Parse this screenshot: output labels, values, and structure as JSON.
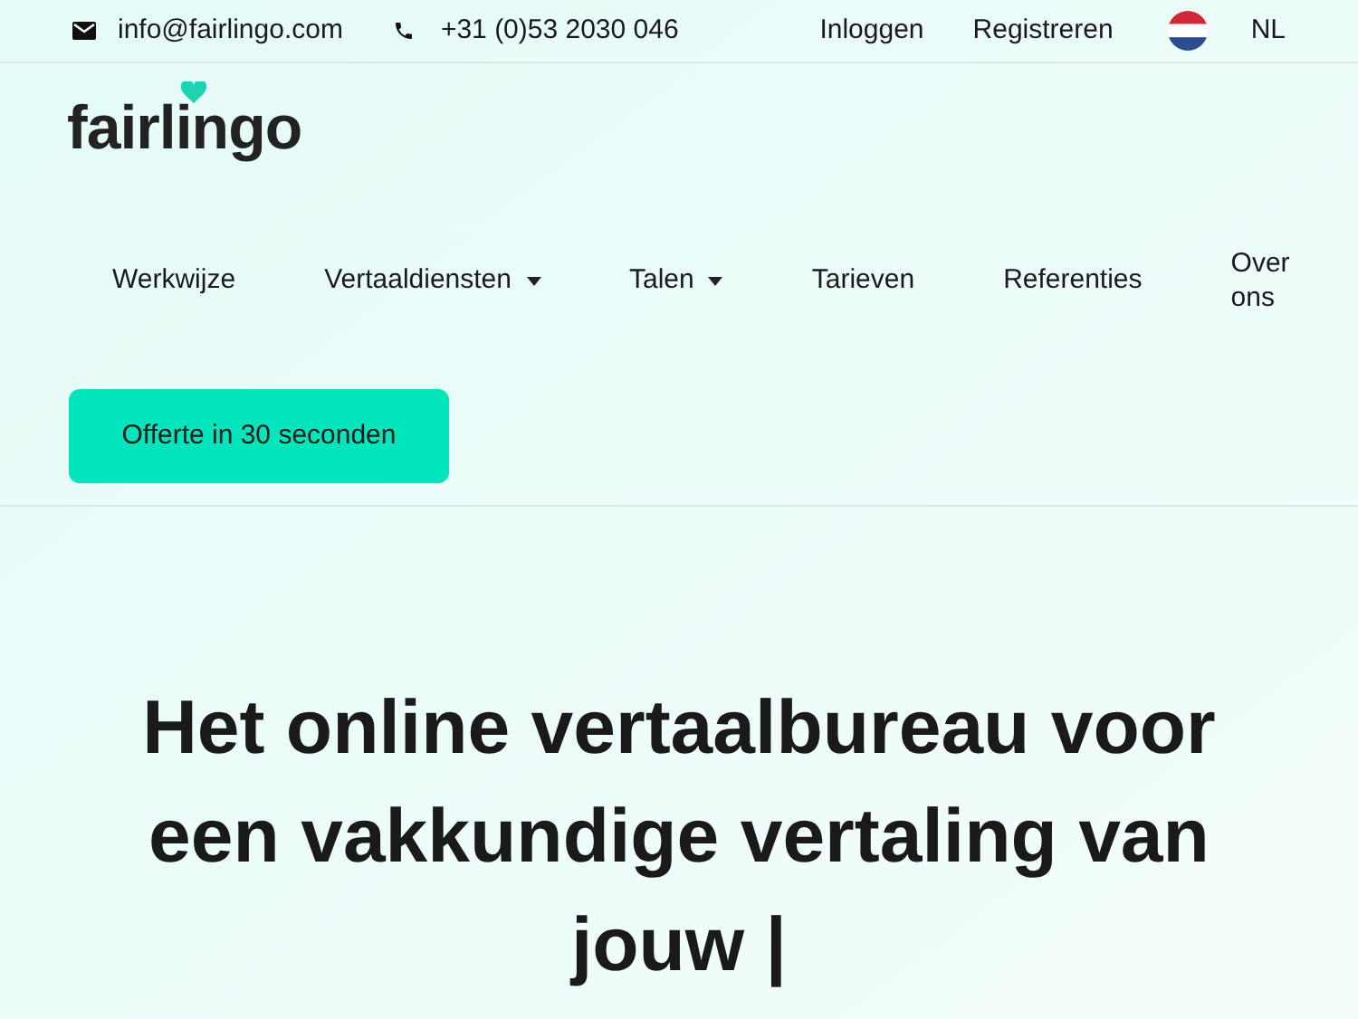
{
  "topbar": {
    "email": "info@fairlingo.com",
    "phone": "+31 (0)53 2030 046",
    "links": [
      "Inloggen",
      "Registreren"
    ],
    "language": "NL"
  },
  "logo": "fairlingo",
  "nav": [
    {
      "label": "Werkwijze",
      "dropdown": false
    },
    {
      "label": "Vertaaldiensten",
      "dropdown": true
    },
    {
      "label": "Talen",
      "dropdown": true
    },
    {
      "label": "Tarieven",
      "dropdown": false
    },
    {
      "label": "Referenties",
      "dropdown": false
    },
    {
      "label": "Over ons",
      "dropdown": false
    }
  ],
  "cta": "Offerte in 30 seconden",
  "headline": "Het online vertaalbureau voor een vakkundige vertaling van jouw |"
}
